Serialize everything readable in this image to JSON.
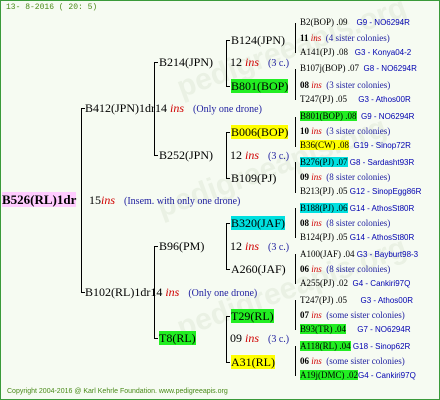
{
  "header": "13- 8-2016 ( 20: 5)",
  "footer": "Copyright 2004-2016 @ Karl Kehrle Foundation.   www.pedigreeapis.org",
  "watermark": "pedigreeapis.org",
  "colors": {
    "green": "#22ee22",
    "yellow": "#ffff00",
    "cyan": "#00e0e0",
    "pink": "#ffccff",
    "ins": "#d00000",
    "note": "#2020a0"
  },
  "root": {
    "name": "B526(RL)1dr",
    "num": "15",
    "ins": "ins",
    "note": "(Insem. with only one drone)"
  },
  "gen1": [
    {
      "name": "B412(JPN)1dr",
      "num": "14",
      "ins": "ins",
      "note": "(Only one drone)"
    },
    {
      "name": "B102(RL)1dr",
      "num": "14",
      "ins": "ins",
      "note": "(Only one drone)"
    }
  ],
  "gen2": [
    {
      "name": "B214(JPN)",
      "num": "12",
      "ins": "ins",
      "note": "(3 c.)"
    },
    {
      "name": "B252(JPN)",
      "num": "12",
      "ins": "ins",
      "note": "(3 c.)"
    },
    {
      "name": "B96(PM)",
      "num": "12",
      "ins": "ins",
      "note": "(3 c.)"
    },
    {
      "name": "T8(RL)",
      "num": "09",
      "ins": "ins",
      "note": "(3 c.)"
    }
  ],
  "gen3": [
    {
      "name": "B124(JPN)",
      "num": "11",
      "ins": "ins",
      "note": "(4 sister colonies)"
    },
    {
      "name": "B801(BOP)",
      "num": "08",
      "ins": "ins",
      "note": "(3 sister colonies)"
    },
    {
      "name": "B006(BOP)",
      "num": "10",
      "ins": "ins",
      "note": "(3 sister colonies)"
    },
    {
      "name": "B109(PJ)",
      "num": "09",
      "ins": "ins",
      "note": "(8 sister colonies)"
    },
    {
      "name": "B320(JAF)",
      "num": "08",
      "ins": "ins",
      "note": "(8 sister colonies)"
    },
    {
      "name": "A260(JAF)",
      "num": "06",
      "ins": "ins",
      "note": "(8 sister colonies)"
    },
    {
      "name": "T29(RL)",
      "num": "07",
      "ins": "ins",
      "note": "(some sister colonies)"
    },
    {
      "name": "A31(RL)",
      "num": "06",
      "ins": "ins",
      "note": "(some sister colonies)"
    }
  ],
  "gen4": [
    {
      "name": "B2(BOP)",
      "yr": ".09",
      "ref": "G9 - NO6294R"
    },
    {
      "name": "A141(PJ)",
      "yr": ".08",
      "ref": "G3 - Konya04-2"
    },
    {
      "name": "B107j(BOP)",
      "yr": ".07",
      "ref": "G8 - NO6294R"
    },
    {
      "name": "T247(PJ)",
      "yr": ".05",
      "ref": "G3 - Athos00R"
    },
    {
      "name": "B801(BOP)",
      "yr": ".08",
      "ref": "G9 - NO6294R"
    },
    {
      "name": "B36(CW)",
      "yr": ".08",
      "ref": "G19 - Sinop72R"
    },
    {
      "name": "B276(PJ)",
      "yr": ".07",
      "ref": "G8 - Sardasht93R"
    },
    {
      "name": "B213(PJ)",
      "yr": ".05",
      "ref": "G12 - SinopEgg86R"
    },
    {
      "name": "B188(PJ)",
      "yr": ".06",
      "ref": "G14 - AthosSt80R"
    },
    {
      "name": "B124(PJ)",
      "yr": ".05",
      "ref": "G14 - AthosSt80R"
    },
    {
      "name": "A100(JAF)",
      "yr": ".04",
      "ref": "G3 - Bayburt98-3"
    },
    {
      "name": "A255(PJ)",
      "yr": ".02",
      "ref": "G4 - Cankiri97Q"
    },
    {
      "name": "T247(PJ)",
      "yr": ".05",
      "ref": "G3 - Athos00R"
    },
    {
      "name": "B93(TR)",
      "yr": ".04",
      "ref": "G7 - NO6294R"
    },
    {
      "name": "A118(RL)",
      "yr": ".04",
      "ref": "G18 - Sinop62R"
    },
    {
      "name": "A19j(DMC)",
      "yr": ".02",
      "ref": "G4 - Cankiri97Q"
    }
  ]
}
